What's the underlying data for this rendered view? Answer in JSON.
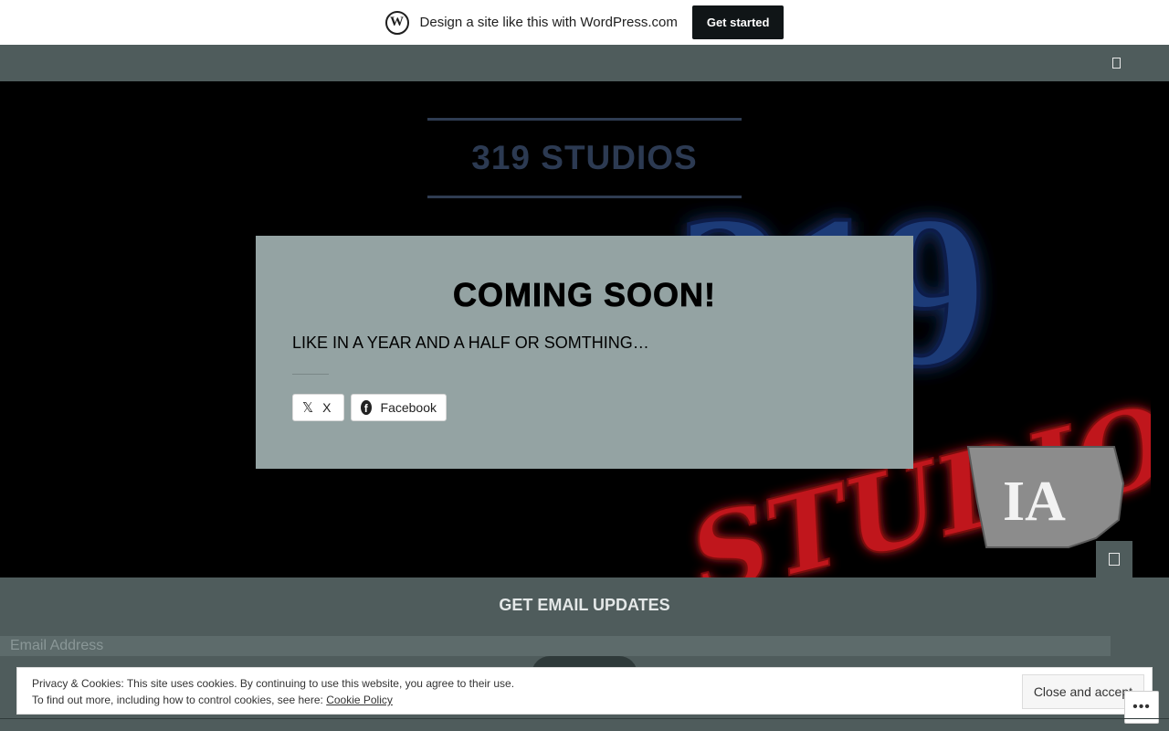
{
  "wp_banner": {
    "logo_letter": "W",
    "text": "Design a site like this with WordPress.com",
    "button": "Get started"
  },
  "site": {
    "title": "319 STUDIOS"
  },
  "modal": {
    "title": "COMING SOON!",
    "text": "LIKE IN A YEAR AND A HALF OR SOMTHING…",
    "share_x": "X",
    "share_x_icon": "𝕏",
    "share_facebook": "Facebook",
    "facebook_icon": "f"
  },
  "logo_art": {
    "numerals": "319",
    "script": "STUDIOS",
    "state": "IA"
  },
  "email": {
    "title": "GET EMAIL UPDATES",
    "placeholder": "Email Address"
  },
  "cookie": {
    "line1": "Privacy & Cookies: This site uses cookies. By continuing to use this website, you agree to their use.",
    "line2_prefix": "To find out more, including how to control cookies, see here:",
    "link": "Cookie Policy",
    "button": "Close and accept",
    "more": "•••"
  },
  "colors": {
    "nav_bg": "#4f5c5c",
    "modal_bg": "#94a3a3",
    "title_color": "#2c3a52"
  }
}
